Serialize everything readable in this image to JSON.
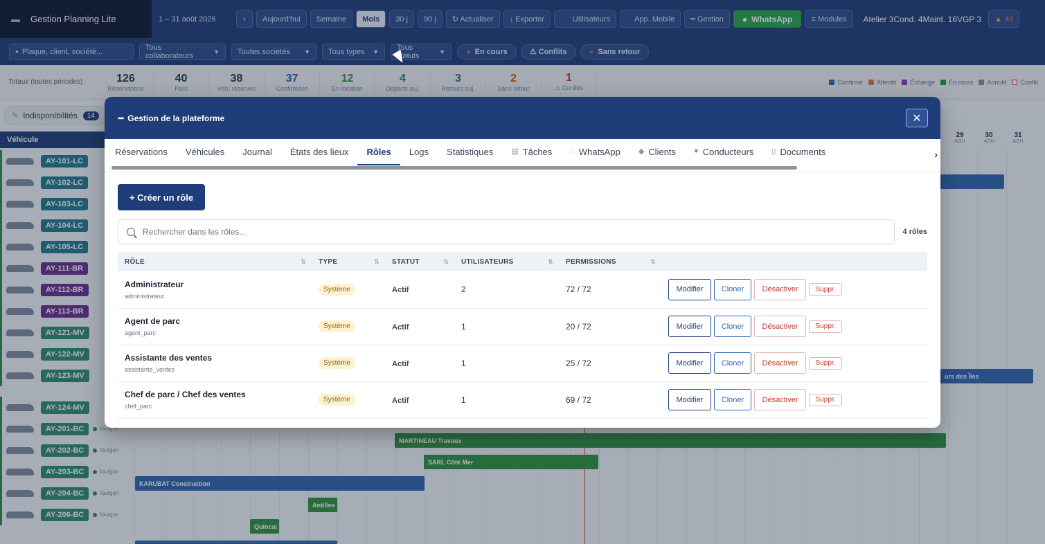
{
  "topbar": {
    "app_title": "Gestion Planning Lite",
    "date_range": "1 – 31 août 2026",
    "next_label": "›",
    "buttons": {
      "today": "Aujourd'hui",
      "week": "Semaine",
      "month": "Mois",
      "d30": "30 j",
      "d90": "90 j",
      "refresh": "↻ Actualiser",
      "export": "↓ Exporter",
      "users": "Utilisateurs",
      "mobile": "App. Mobile",
      "manage": "━ Gestion",
      "whatsapp": "WhatsApp",
      "modules": "≡ Modules"
    },
    "counts_text": "Atelier 3Cond. 4Maint. 16VGP 3",
    "alert_count": "43"
  },
  "filters": {
    "search_placeholder": "Plaque, client, société...",
    "collaborators": "Tous collaborateurs",
    "companies": "Toutes sociétés",
    "types": "Tous types",
    "statuses": "Tous statuts",
    "pill_ongoing": "En cours",
    "pill_conflicts": "⚠ Conflits",
    "pill_noreturn": "Sans retour"
  },
  "stats": {
    "label": "Totaux (toutes périodes)",
    "items": [
      {
        "n": "126",
        "l": "Réservations",
        "c": "#2b3445"
      },
      {
        "n": "40",
        "l": "Parc",
        "c": "#2b3445"
      },
      {
        "n": "38",
        "l": "Véh. réservés",
        "c": "#2b3445"
      },
      {
        "n": "37",
        "l": "Confirmées",
        "c": "#2f66b0"
      },
      {
        "n": "12",
        "l": "En location",
        "c": "#2f8f3e"
      },
      {
        "n": "4",
        "l": "Départs auj.",
        "c": "#1f7a8c"
      },
      {
        "n": "3",
        "l": "Retours auj.",
        "c": "#2f66b0"
      },
      {
        "n": "2",
        "l": "Sans retour",
        "c": "#d35400"
      },
      {
        "n": "1",
        "l": "⚠ Conflits",
        "c": "#c0392b"
      }
    ],
    "legend": [
      {
        "label": "Confirmé",
        "color": "#2f66b0"
      },
      {
        "label": "Attente",
        "color": "#d9773a"
      },
      {
        "label": "Échange",
        "color": "#7b3fb0"
      },
      {
        "label": "En cours",
        "color": "#2f8f3e"
      },
      {
        "label": "Annulé",
        "color": "#8a8f99"
      },
      {
        "label": "Conflit",
        "color": "#ffffff"
      }
    ]
  },
  "planning": {
    "indispo_label": "Indisponibilités",
    "indispo_count": "14",
    "vehicle_header": "Véhicule",
    "day_headers": [
      {
        "d": "29",
        "m": "AOÛ"
      },
      {
        "d": "30",
        "m": "AOÛ"
      },
      {
        "d": "31",
        "m": "AOÛ"
      }
    ],
    "vehicles": [
      {
        "plate": "AY-101-LC",
        "cls": "teal",
        "cat": ""
      },
      {
        "plate": "AY-102-LC",
        "cls": "teal",
        "cat": ""
      },
      {
        "plate": "AY-103-LC",
        "cls": "teal",
        "cat": ""
      },
      {
        "plate": "AY-104-LC",
        "cls": "teal",
        "cat": ""
      },
      {
        "plate": "AY-105-LC",
        "cls": "teal",
        "cat": ""
      },
      {
        "plate": "AY-111-BR",
        "cls": "purple",
        "cat": ""
      },
      {
        "plate": "AY-112-BR",
        "cls": "purple",
        "cat": ""
      },
      {
        "plate": "AY-113-BR",
        "cls": "purple",
        "cat": ""
      },
      {
        "plate": "AY-121-MV",
        "cls": "green",
        "cat": ""
      },
      {
        "plate": "AY-122-MV",
        "cls": "green",
        "cat": ""
      },
      {
        "plate": "AY-123-MV",
        "cls": "green",
        "cat": ""
      },
      {
        "plate": "AY-124-MV",
        "cls": "green",
        "cat": ""
      },
      {
        "plate": "AY-201-BC",
        "cls": "green",
        "cat": "fourgon"
      },
      {
        "plate": "AY-202-BC",
        "cls": "green",
        "cat": "fourgon"
      },
      {
        "plate": "AY-203-BC",
        "cls": "green",
        "cat": "fourgon"
      },
      {
        "plate": "AY-204-BC",
        "cls": "green",
        "cat": "fourgon"
      },
      {
        "plate": "AY-206-BC",
        "cls": "green",
        "cat": "fourgon"
      }
    ],
    "bookings": {
      "b1": "MARTINEAU Travaux",
      "b2": "SARL Côté Mer",
      "b3": "KARUBAT Construction",
      "b4": "Antilles",
      "b5": "Quincai",
      "b6": "urs des Îles"
    }
  },
  "modal": {
    "title": "Gestion de la plateforme",
    "close": "✕",
    "tabs": [
      {
        "label": "Réservations",
        "icon": ""
      },
      {
        "label": "Véhicules",
        "icon": ""
      },
      {
        "label": "Journal",
        "icon": ""
      },
      {
        "label": "États des lieux",
        "icon": ""
      },
      {
        "label": "Rôles",
        "icon": ""
      },
      {
        "label": "Logs",
        "icon": ""
      },
      {
        "label": "Statistiques",
        "icon": ""
      },
      {
        "label": "Tâches",
        "icon": "▤"
      },
      {
        "label": "WhatsApp",
        "icon": "◌"
      },
      {
        "label": "Clients",
        "icon": "◆"
      },
      {
        "label": "Conducteurs",
        "icon": "●"
      },
      {
        "label": "Documents",
        "icon": "▯"
      }
    ],
    "active_tab": "Rôles",
    "create_label": "+ Créer un rôle",
    "search_placeholder": "Rechercher dans les rôles...",
    "role_count": "4 rôles",
    "columns": [
      "RÔLE",
      "TYPE",
      "STATUT",
      "UTILISATEURS",
      "PERMISSIONS"
    ],
    "actions": {
      "modify": "Modifier",
      "clone": "Cloner",
      "deactivate": "Désactiver",
      "delete": "Suppr."
    },
    "rows": [
      {
        "name": "Administrateur",
        "slug": "administrateur",
        "type": "Système",
        "status": "Actif",
        "users": "2",
        "perms": "72 / 72"
      },
      {
        "name": "Agent de parc",
        "slug": "agent_parc",
        "type": "Système",
        "status": "Actif",
        "users": "1",
        "perms": "20 / 72"
      },
      {
        "name": "Assistante des ventes",
        "slug": "assistante_ventes",
        "type": "Système",
        "status": "Actif",
        "users": "1",
        "perms": "25 / 72"
      },
      {
        "name": "Chef de parc / Chef des ventes",
        "slug": "chef_parc",
        "type": "Système",
        "status": "Actif",
        "users": "1",
        "perms": "69 / 72"
      }
    ]
  }
}
